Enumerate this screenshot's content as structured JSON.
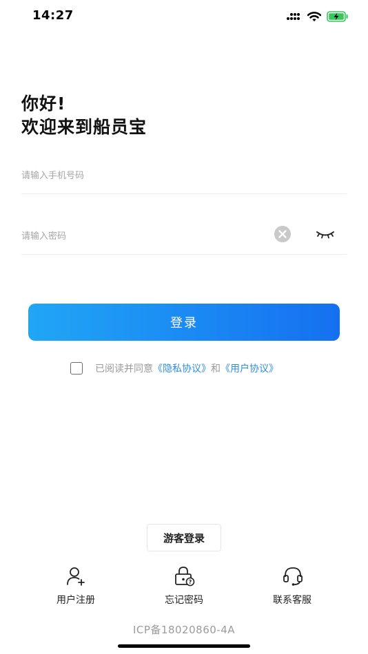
{
  "status_bar": {
    "time": "14:27"
  },
  "greeting": {
    "line1": "你好!",
    "line2": "欢迎来到船员宝"
  },
  "phone_field": {
    "value": "",
    "placeholder": "请输入手机号码"
  },
  "password_field": {
    "value": "",
    "placeholder": "请输入密码"
  },
  "login_button": {
    "label": "登录"
  },
  "agreement": {
    "checked": false,
    "prefix": "已阅读并同意",
    "privacy_link": "《隐私协议》",
    "conjunction": "和",
    "user_link": "《用户协议》"
  },
  "guest_button": {
    "label": "游客登录"
  },
  "actions": [
    {
      "label": "用户注册",
      "icon": "user-add-icon"
    },
    {
      "label": "忘记密码",
      "icon": "lock-question-icon"
    },
    {
      "label": "联系客服",
      "icon": "headset-icon"
    }
  ],
  "icp": "ICP备18020860-4A",
  "colors": {
    "primary_gradient_start": "#21a6f6",
    "primary_gradient_end": "#1570f0",
    "link": "#2f8fdc",
    "battery": "#35c759"
  }
}
